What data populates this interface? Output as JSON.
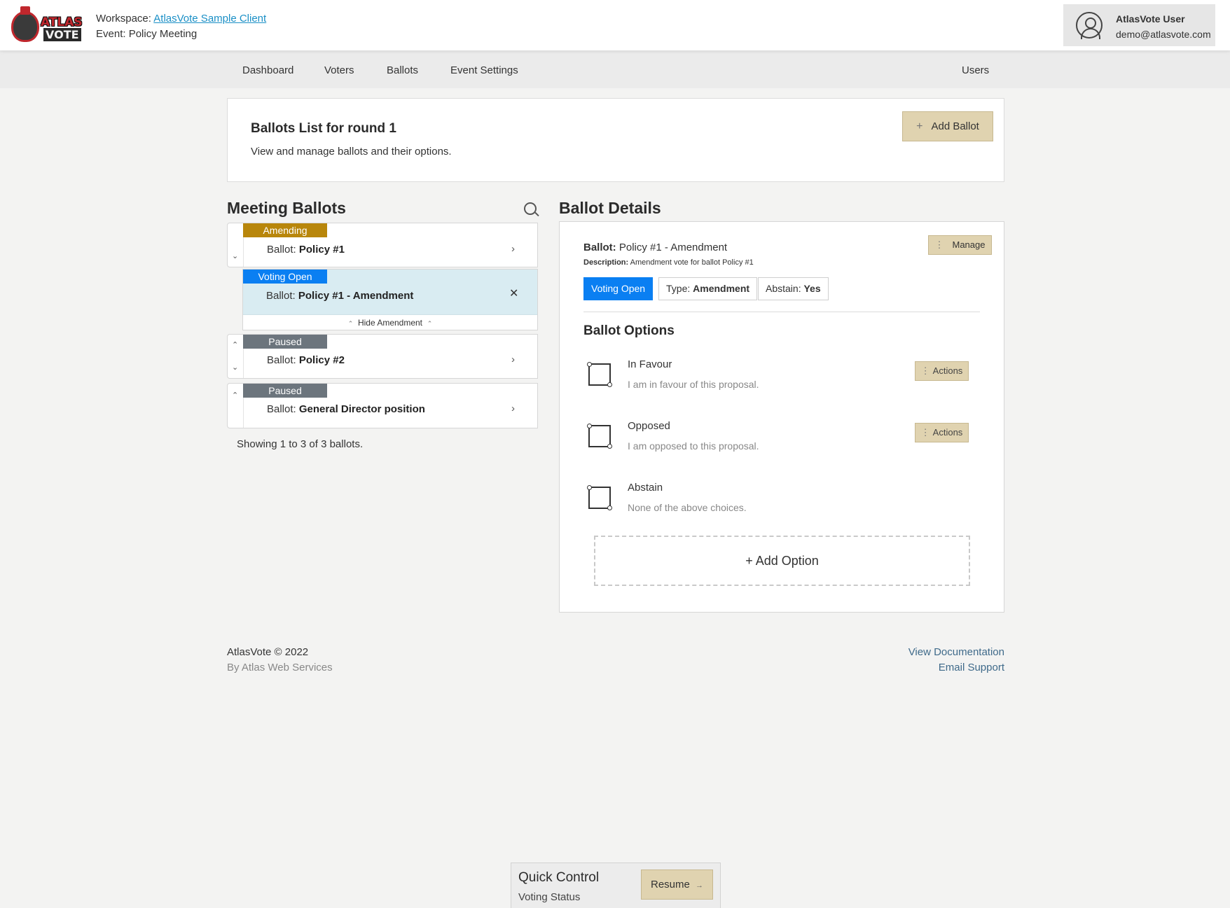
{
  "header": {
    "logo_text_top": "ATLAS",
    "logo_text_bottom": "VOTE",
    "workspace_label": "Workspace: ",
    "workspace_name": "AtlasVote Sample Client",
    "event_label": "Event: Policy Meeting",
    "user_name": "AtlasVote User",
    "user_email": "demo@atlasvote.com"
  },
  "nav": {
    "items": [
      "Dashboard",
      "Voters",
      "Ballots",
      "Event Settings"
    ],
    "right_item": "Users"
  },
  "list_header": {
    "title": "Ballots List for round 1",
    "subtitle": "View and manage ballots and their options.",
    "add_ballot_label": "Add Ballot"
  },
  "meeting_ballots": {
    "title": "Meeting Ballots",
    "ballot_prefix": "Ballot:",
    "items": [
      {
        "status": "Amending",
        "name": "Policy #1"
      },
      {
        "status": "Voting Open",
        "name": "Policy #1 - Amendment"
      },
      {
        "status": "Paused",
        "name": "Policy #2"
      },
      {
        "status": "Paused",
        "name": "General Director position"
      }
    ],
    "hide_amendment_label": "Hide Amendment",
    "showing_text": "Showing 1 to 3 of 3 ballots."
  },
  "ballot_details": {
    "title": "Ballot Details",
    "ballot_label": "Ballot:",
    "ballot_name": "Policy #1 - Amendment",
    "description_label": "Description:",
    "description": "Amendment vote for ballot Policy #1",
    "manage_label": "Manage",
    "status_tag": "Voting Open",
    "type_label": "Type:",
    "type_value": "Amendment",
    "abstain_label": "Abstain:",
    "abstain_value": "Yes",
    "options_title": "Ballot Options",
    "options": [
      {
        "name": "In Favour",
        "description": "I am in favour of this proposal.",
        "actions_label": "Actions"
      },
      {
        "name": "Opposed",
        "description": "I am opposed to this proposal.",
        "actions_label": "Actions"
      },
      {
        "name": "Abstain",
        "description": "None of the above choices."
      }
    ],
    "add_option_label": "+ Add Option"
  },
  "footer": {
    "copyright": "AtlasVote © 2022",
    "by_line": "By Atlas Web Services",
    "docs_link": "View Documentation",
    "support_link": "Email Support"
  },
  "quick_control": {
    "title": "Quick Control",
    "status_label": "Voting Status",
    "resume_label": "Resume"
  },
  "colors": {
    "amending": "#b8860b",
    "voting_open": "#0a7ff2",
    "paused": "#6c757d",
    "button_tan": "#e0d3b0",
    "selected_row": "#d9ecf2"
  }
}
